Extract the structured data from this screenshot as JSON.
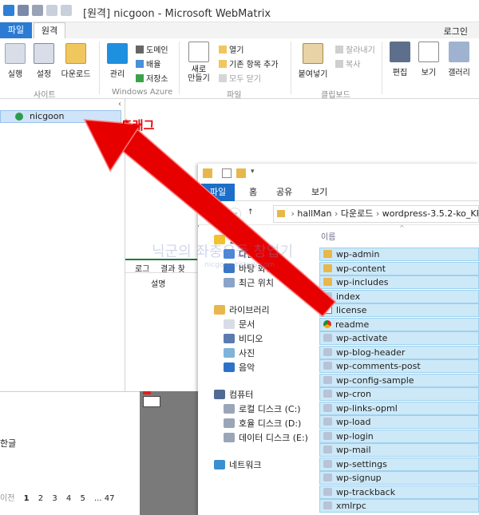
{
  "window": {
    "title": "[원격] nicgoon - Microsoft WebMatrix",
    "login": "로그인"
  },
  "ribbon_tabs": {
    "file": "파일",
    "home": "원격"
  },
  "ribbon": {
    "run": "실행",
    "settings": "설정",
    "download": "다운로드",
    "manage": "관리",
    "domain": "도메인",
    "deploy": "배율",
    "store": "저장소",
    "new": "새로\n만들기",
    "open": "열기",
    "recent": "기존 항목 추가",
    "close_all": "모두 닫기",
    "paste": "붙여넣기",
    "cut": "잘라내기",
    "copy": "복사",
    "edit": "편집",
    "view": "보기",
    "gallery": "갤러리",
    "group_site": "사이트",
    "group_azure": "Windows Azure",
    "group_file": "파일",
    "group_clipboard": "클립보드"
  },
  "site_panel": {
    "site_name": "nicgoon"
  },
  "log_panel": {
    "tab_log": "로그",
    "tab_result": "결과 찾",
    "col_desc": "설명"
  },
  "bottom_left": {
    "lang": "한글",
    "pager_prev": "이전",
    "pages": [
      "1",
      "2",
      "3",
      "4",
      "5"
    ],
    "pager_more": "... 47"
  },
  "annotation": {
    "drag_label": "드래그"
  },
  "watermark": {
    "text": "닉군의 좌충우돌 창업기",
    "url": "nicgoon.tistory.com"
  },
  "explorer": {
    "tabs": {
      "file": "파일",
      "home": "홈",
      "share": "공유",
      "view": "보기"
    },
    "address": {
      "parts": [
        "hallMan",
        "다운로드",
        "wordpress-3.5.2-ko_KR"
      ]
    },
    "column_name": "이름",
    "nav": {
      "favorites": "즐겨찾기",
      "downloads": "다운로드",
      "desktop": "바탕 화면",
      "recent": "최근 위치",
      "libraries": "라이브러리",
      "documents": "문서",
      "videos": "비디오",
      "pictures": "사진",
      "music": "음악",
      "computer": "컴퓨터",
      "local_c": "로컬 디스크 (C:)",
      "disk_d": "호율 디스크 (D:)",
      "disk_e": "데이터 디스크 (E:)",
      "network": "네트워크"
    },
    "files": [
      {
        "name": "wp-admin",
        "type": "folder"
      },
      {
        "name": "wp-content",
        "type": "folder"
      },
      {
        "name": "wp-includes",
        "type": "folder"
      },
      {
        "name": "index",
        "type": "php"
      },
      {
        "name": "license",
        "type": "doc"
      },
      {
        "name": "readme",
        "type": "chrome"
      },
      {
        "name": "wp-activate",
        "type": "php"
      },
      {
        "name": "wp-blog-header",
        "type": "php"
      },
      {
        "name": "wp-comments-post",
        "type": "php"
      },
      {
        "name": "wp-config-sample",
        "type": "php"
      },
      {
        "name": "wp-cron",
        "type": "php"
      },
      {
        "name": "wp-links-opml",
        "type": "php"
      },
      {
        "name": "wp-load",
        "type": "php"
      },
      {
        "name": "wp-login",
        "type": "php"
      },
      {
        "name": "wp-mail",
        "type": "php"
      },
      {
        "name": "wp-settings",
        "type": "php"
      },
      {
        "name": "wp-signup",
        "type": "php"
      },
      {
        "name": "wp-trackback",
        "type": "php"
      },
      {
        "name": "xmlrpc",
        "type": "php"
      }
    ]
  },
  "colors": {
    "accent": "#2b7bd4",
    "selection": "#cde8f7",
    "arrow": "#e60000"
  }
}
